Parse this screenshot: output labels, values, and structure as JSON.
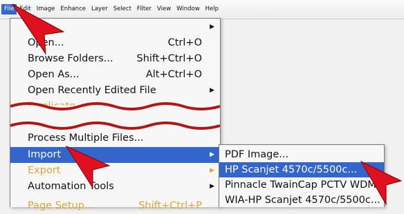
{
  "menubar": {
    "items": [
      "File",
      "Edit",
      "Image",
      "Enhance",
      "Layer",
      "Select",
      "Filter",
      "View",
      "Window",
      "Help"
    ]
  },
  "file_menu": {
    "items": [
      {
        "label": "",
        "shortcut": "",
        "submenu": true
      },
      {
        "label": "Open...",
        "shortcut": "Ctrl+O"
      },
      {
        "label": "Browse Folders...",
        "shortcut": "Shift+Ctrl+O"
      },
      {
        "label": "Open As...",
        "shortcut": "Alt+Ctrl+O"
      },
      {
        "label": "Open Recently Edited File",
        "shortcut": "",
        "submenu": true
      },
      {
        "label": "Duplicate...",
        "state": "disabled"
      },
      {
        "label": "Process Multiple Files..."
      },
      {
        "label": "Import",
        "submenu": true,
        "state": "selected"
      },
      {
        "label": "Export",
        "submenu": true,
        "state": "disabled"
      },
      {
        "label": "Automation Tools",
        "submenu": true
      },
      {
        "label": "Page Setup...",
        "shortcut": "Shift+Ctrl+P",
        "state": "disabled"
      }
    ]
  },
  "import_submenu": {
    "items": [
      {
        "label": "PDF Image..."
      },
      {
        "label": "HP Scanjet 4570c/5500c...",
        "state": "selected"
      },
      {
        "label": "Pinnacle TwainCap PCTV WDM"
      },
      {
        "label": "WIA-HP Scanjet 4570c/5500c..."
      }
    ]
  },
  "colors": {
    "highlight": "#3366cc",
    "disabled_text": "#d8a83a",
    "annotation_arrow": "#e0101e",
    "wave": "#b01818"
  }
}
